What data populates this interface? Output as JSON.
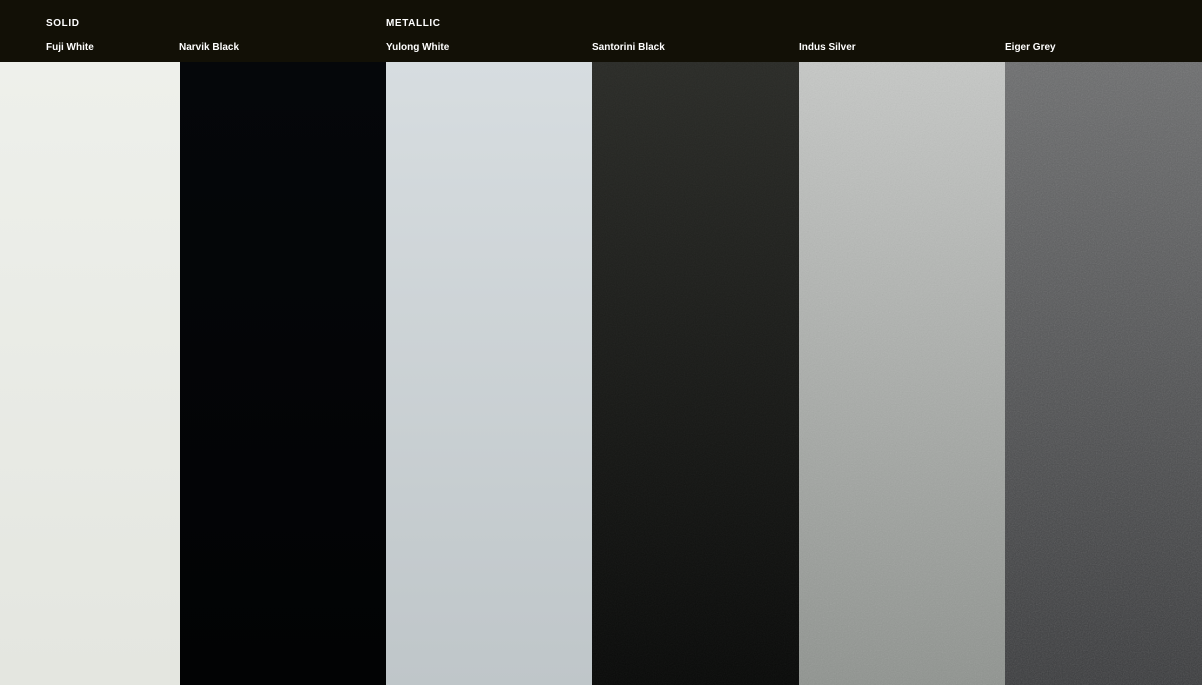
{
  "groups": {
    "solid": "SOLID",
    "metallic": "METALLIC"
  },
  "colors": [
    {
      "name": "Fuji White",
      "type": "solid",
      "top": "#eef0eb",
      "bottom": "#e4e6e0"
    },
    {
      "name": "Narvik Black",
      "type": "solid",
      "top": "#05070a",
      "bottom": "#020304"
    },
    {
      "name": "Yulong White",
      "type": "metallic",
      "top": "#d7dde0",
      "bottom": "#bfc6c9"
    },
    {
      "name": "Santorini Black",
      "type": "metallic",
      "top": "#2a2b27",
      "bottom": "#090a09"
    },
    {
      "name": "Indus Silver",
      "type": "metallic",
      "top": "#c6c8c6",
      "bottom": "#8f938f"
    },
    {
      "name": "Eiger Grey",
      "type": "metallic",
      "top": "#6c6d6e",
      "bottom": "#3a3b3d"
    }
  ],
  "header_color": "#121006"
}
